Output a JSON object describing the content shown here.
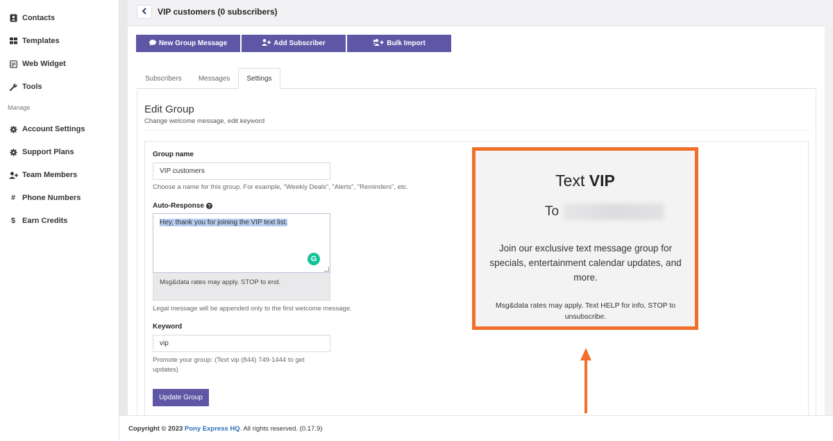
{
  "sidebar": {
    "items": [
      {
        "label": "Contacts",
        "icon": "contacts-icon"
      },
      {
        "label": "Templates",
        "icon": "grid-icon"
      },
      {
        "label": "Web Widget",
        "icon": "widget-icon"
      },
      {
        "label": "Tools",
        "icon": "wrench-icon"
      }
    ],
    "heading": "Manage",
    "manage_items": [
      {
        "label": "Account Settings",
        "icon": "gear-icon"
      },
      {
        "label": "Support Plans",
        "icon": "gear-icon"
      },
      {
        "label": "Team Members",
        "icon": "add-user-icon"
      },
      {
        "label": "Phone Numbers",
        "icon": "hash-icon"
      },
      {
        "label": "Earn Credits",
        "icon": "dollar-icon"
      }
    ]
  },
  "header": {
    "title": "VIP customers (0 subscribers)"
  },
  "actions": {
    "new_message": "New Group Message",
    "add_subscriber": "Add Subscriber",
    "bulk_import": "Bulk Import"
  },
  "tabs": [
    "Subscribers",
    "Messages",
    "Settings"
  ],
  "active_tab": "Settings",
  "edit": {
    "title": "Edit Group",
    "subtitle": "Change welcome message, edit keyword"
  },
  "form": {
    "group_name_label": "Group name",
    "group_name_value": "VIP customers",
    "group_name_help": "Choose a name for this group. For example, \"Weekly Deals\", \"Alerts\", \"Reminders\", etc.",
    "auto_response_label": "Auto-Response",
    "auto_response_value": "Hey, thank you for joining the VIP text list.",
    "legal_text": "Msg&data rates may apply. STOP to end.",
    "legal_help": "Legal message will be appended only to the first welcome message.",
    "keyword_label": "Keyword",
    "keyword_value": "vip",
    "keyword_help": "Promote your group: (Text vip (844) 749-1444 to get updates)",
    "update_button": "Update Group"
  },
  "preview": {
    "title_prefix": "Text",
    "title_keyword": "VIP",
    "to_label": "To",
    "body": "Join our exclusive text message group for specials, entertainment calendar updates, and more.",
    "small": "Msg&data rates may apply. Text HELP for info, STOP to unsubscribe.",
    "border_color": "#f26f2b"
  },
  "footer": {
    "copyright": "Copyright © 2023",
    "company": "Pony Express HQ",
    "rights": ". All rights reserved. (0.17.9)"
  },
  "colors": {
    "accent": "#5f57a6",
    "highlight": "#f26f2b",
    "link": "#2a6fb5"
  }
}
